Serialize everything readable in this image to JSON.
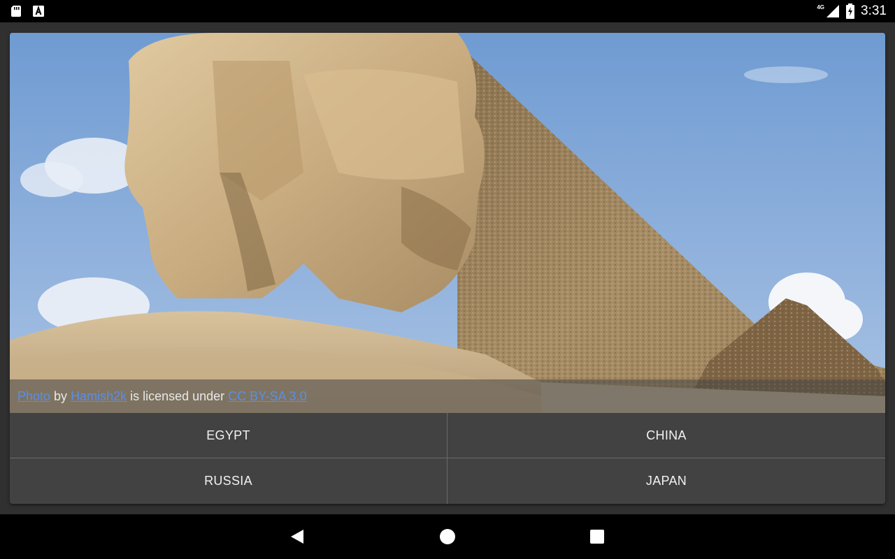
{
  "status_bar": {
    "time": "3:31",
    "network_label": "4G",
    "left_icons": [
      "sd-card-icon",
      "font-download-icon"
    ],
    "right_icons": [
      "cell-signal-icon",
      "battery-charging-icon"
    ]
  },
  "photo": {
    "alt": "Sphinx and pyramid",
    "attribution": {
      "photo_link": "Photo",
      "by": " by ",
      "author_link": "Hamish2k",
      "licensed": " is licensed under ",
      "license_link": "CC BY-SA 3.0"
    }
  },
  "answers": [
    {
      "label": "EGYPT"
    },
    {
      "label": "CHINA"
    },
    {
      "label": "RUSSIA"
    },
    {
      "label": "JAPAN"
    }
  ],
  "nav_bar": {
    "icons": [
      "back-icon",
      "home-icon",
      "recents-icon"
    ]
  }
}
